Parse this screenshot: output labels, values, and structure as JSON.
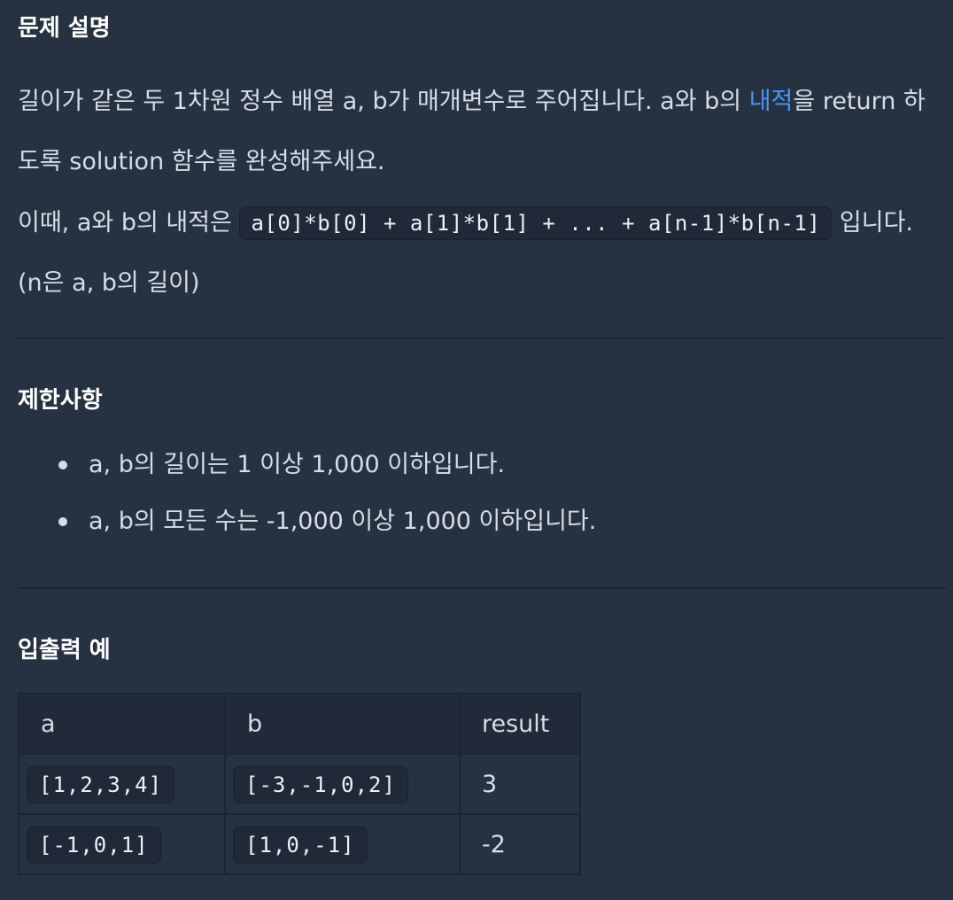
{
  "sections": {
    "description": {
      "heading": "문제 설명",
      "line1_before": "길이가 같은 두 1차원 정수 배열 a, b가 매개변수로 주어집니다. a와 b의 ",
      "line1_link": "내적",
      "line1_after": "을 return 하도록 solution 함수를 완성해주세요.",
      "line2_before": "이때, a와 b의 내적은 ",
      "line2_code": "a[0]*b[0] + a[1]*b[1] + ... + a[n-1]*b[n-1]",
      "line2_after": " 입니다. (n은 a, b의 길이)"
    },
    "constraints": {
      "heading": "제한사항",
      "items": [
        "a, b의 길이는 1 이상 1,000 이하입니다.",
        "a, b의 모든 수는 -1,000 이상 1,000 이하입니다."
      ]
    },
    "examples": {
      "heading": "입출력 예",
      "columns": [
        "a",
        "b",
        "result"
      ],
      "rows": [
        [
          "[1,2,3,4]",
          "[-3,-1,0,2]",
          "3"
        ],
        [
          "[-1,0,1]",
          "[1,0,-1]",
          "-2"
        ]
      ]
    }
  },
  "colors": {
    "background": "#263241",
    "text": "#d5dde6",
    "heading": "#ffffff",
    "link": "#4c95f3",
    "code_bg": "#1f2937",
    "divider": "#1b2532"
  }
}
